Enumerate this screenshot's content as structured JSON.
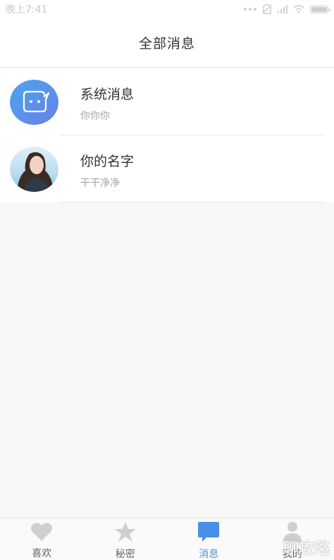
{
  "status_bar": {
    "time": "晚上7:41",
    "icons": [
      "dots-icon",
      "no-sim-icon",
      "signal-icon",
      "wifi-icon",
      "battery-icon"
    ]
  },
  "header": {
    "title": "全部消息"
  },
  "messages": [
    {
      "title": "系统消息",
      "subtitle": "你你你",
      "avatar": "robot-chat-icon",
      "avatar_color": "#5a8fe8"
    },
    {
      "title": "你的名字",
      "subtitle": "干干净净",
      "avatar": "user-photo"
    }
  ],
  "tabbar": {
    "tabs": [
      {
        "label": "喜欢",
        "icon": "heart-icon"
      },
      {
        "label": "秘密",
        "icon": "star-icon"
      },
      {
        "label": "消息",
        "icon": "chat-bubble-icon",
        "active": true
      },
      {
        "label": "我的",
        "icon": "person-icon"
      }
    ],
    "active_color": "#4a8ee6",
    "inactive_color": "#cfcfcf"
  },
  "watermark": "聊攻略"
}
